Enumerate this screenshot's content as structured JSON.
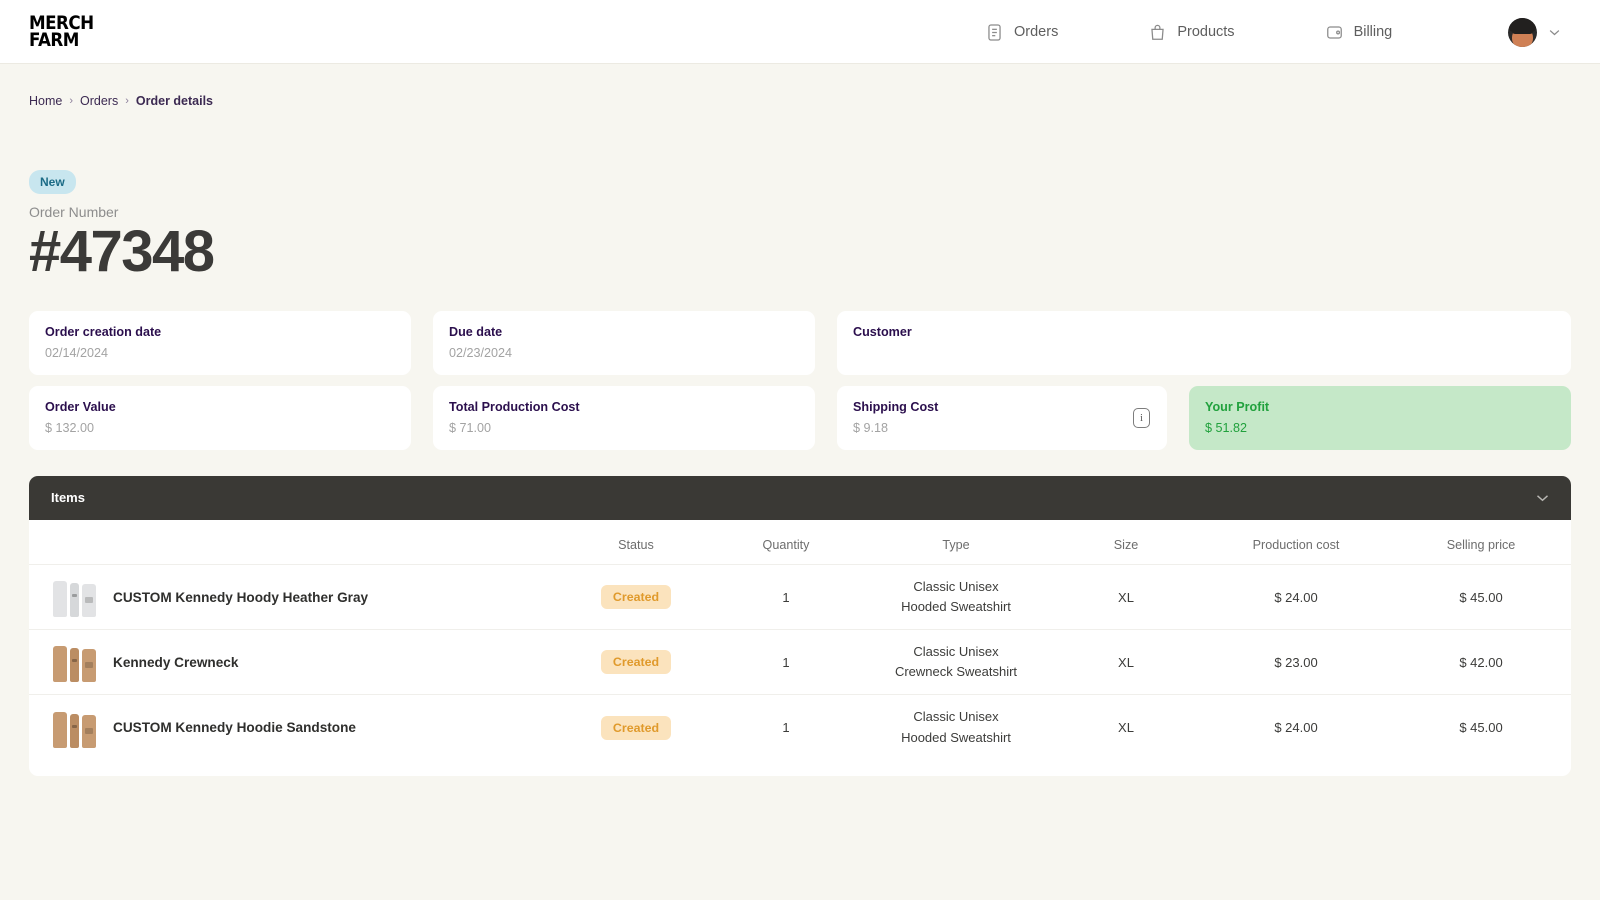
{
  "brand": {
    "line1": "MERCH",
    "line2": "FARM"
  },
  "nav": {
    "items": [
      {
        "label": "Orders",
        "icon": "document-icon"
      },
      {
        "label": "Products",
        "icon": "bag-icon"
      },
      {
        "label": "Billing",
        "icon": "wallet-icon"
      }
    ],
    "profile": {
      "icon": "avatar",
      "chevron": "chevron-down-icon"
    }
  },
  "breadcrumb": {
    "home": "Home",
    "orders": "Orders",
    "current": "Order details",
    "separator": "›"
  },
  "order": {
    "status_badge": "New",
    "number_label": "Order Number",
    "number": "#47348"
  },
  "cards": {
    "creation_date": {
      "label": "Order creation date",
      "value": "02/14/2024"
    },
    "due_date": {
      "label": "Due date",
      "value": "02/23/2024"
    },
    "customer": {
      "label": "Customer",
      "value": ""
    },
    "order_value": {
      "label": "Order Value",
      "value": "$ 132.00"
    },
    "production_cost": {
      "label": "Total Production Cost",
      "value": "$ 71.00"
    },
    "shipping_cost": {
      "label": "Shipping Cost",
      "value": "$ 9.18",
      "info": "i"
    },
    "profit": {
      "label": "Your Profit",
      "value": "$ 51.82"
    }
  },
  "items": {
    "title": "Items",
    "collapse_icon": "chevron-down-icon",
    "columns": [
      "",
      "Status",
      "Quantity",
      "Type",
      "Size",
      "Production cost",
      "Selling price"
    ],
    "rows": [
      {
        "name": "CUSTOM Kennedy Hoody Heather Gray",
        "thumb": "gray",
        "status": "Created",
        "quantity": "1",
        "type_line1": "Classic Unisex",
        "type_line2": "Hooded Sweatshirt",
        "size": "XL",
        "production_cost": "$ 24.00",
        "selling_price": "$ 45.00"
      },
      {
        "name": "Kennedy Crewneck",
        "thumb": "tan",
        "status": "Created",
        "quantity": "1",
        "type_line1": "Classic Unisex",
        "type_line2": "Crewneck Sweatshirt",
        "size": "XL",
        "production_cost": "$ 23.00",
        "selling_price": "$ 42.00"
      },
      {
        "name": "CUSTOM Kennedy Hoodie Sandstone",
        "thumb": "tan",
        "status": "Created",
        "quantity": "1",
        "type_line1": "Classic Unisex",
        "type_line2": "Hooded Sweatshirt",
        "size": "XL",
        "production_cost": "$ 24.00",
        "selling_price": "$ 45.00"
      }
    ]
  },
  "colors": {
    "background": "#f7f6f0",
    "badge_new_bg": "#c8e6ef",
    "badge_new_text": "#1b6b86",
    "profit_bg": "#c5e8c8",
    "profit_text": "#21a13d",
    "status_pill_bg": "#fbe3bd",
    "status_pill_text": "#e09a2c",
    "items_header_bg": "#3a3935",
    "breadcrumb_text": "#3c2a52"
  }
}
